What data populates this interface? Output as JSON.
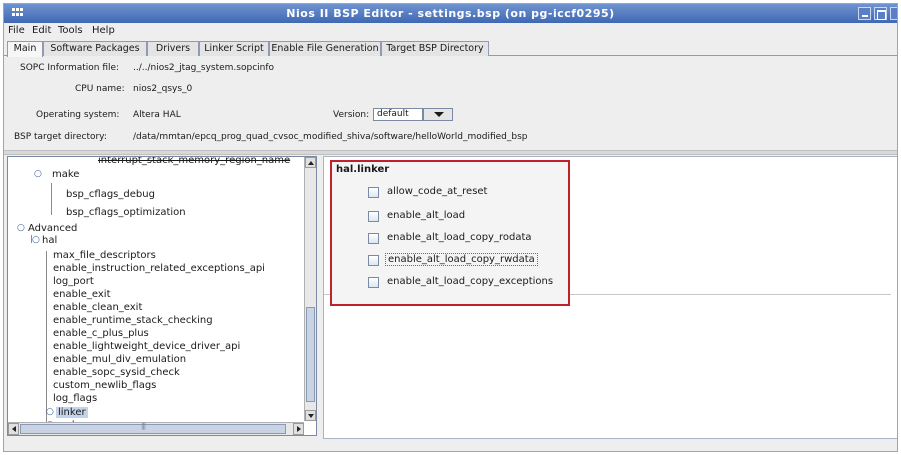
{
  "window": {
    "title": "Nios II BSP Editor - settings.bsp (on pg-iccf0295)",
    "icon": "app-grid-icon"
  },
  "menu": [
    "File",
    "Edit",
    "Tools",
    "Help"
  ],
  "tabs": [
    "Main",
    "Software Packages",
    "Drivers",
    "Linker Script",
    "Enable File Generation",
    "Target BSP Directory"
  ],
  "info": {
    "sopc_label": "SOPC Information file:",
    "sopc_value": "../../nios2_jtag_system.sopcinfo",
    "cpu_label": "CPU name:",
    "cpu_value": "nios2_qsys_0",
    "os_label": "Operating system:",
    "os_value": "Altera HAL",
    "version_label": "Version:",
    "version_value": "default",
    "bsp_label": "BSP target directory:",
    "bsp_value": "/data/mmtan/epcq_prog_quad_cvsoc_modified_shiva/software/helloWorld_modified_bsp"
  },
  "tree": {
    "items": [
      "interrupt_stack_memory_region_name",
      "make",
      "bsp_cflags_debug",
      "bsp_cflags_optimization",
      "Advanced",
      "hal",
      "max_file_descriptors",
      "enable_instruction_related_exceptions_api",
      "log_port",
      "enable_exit",
      "enable_clean_exit",
      "enable_runtime_stack_checking",
      "enable_c_plus_plus",
      "enable_lightweight_device_driver_api",
      "enable_mul_div_emulation",
      "enable_sopc_sysid_check",
      "custom_newlib_flags",
      "log_flags",
      "linker",
      "make"
    ]
  },
  "panel": {
    "section_title": "hal.linker",
    "options": [
      "allow_code_at_reset",
      "enable_alt_load",
      "enable_alt_load_copy_rodata",
      "enable_alt_load_copy_rwdata",
      "enable_alt_load_copy_exceptions"
    ]
  },
  "colors": {
    "title_bar": "#4a73bd",
    "highlight_border": "#c0202a",
    "selection": "#c4d3ea"
  }
}
